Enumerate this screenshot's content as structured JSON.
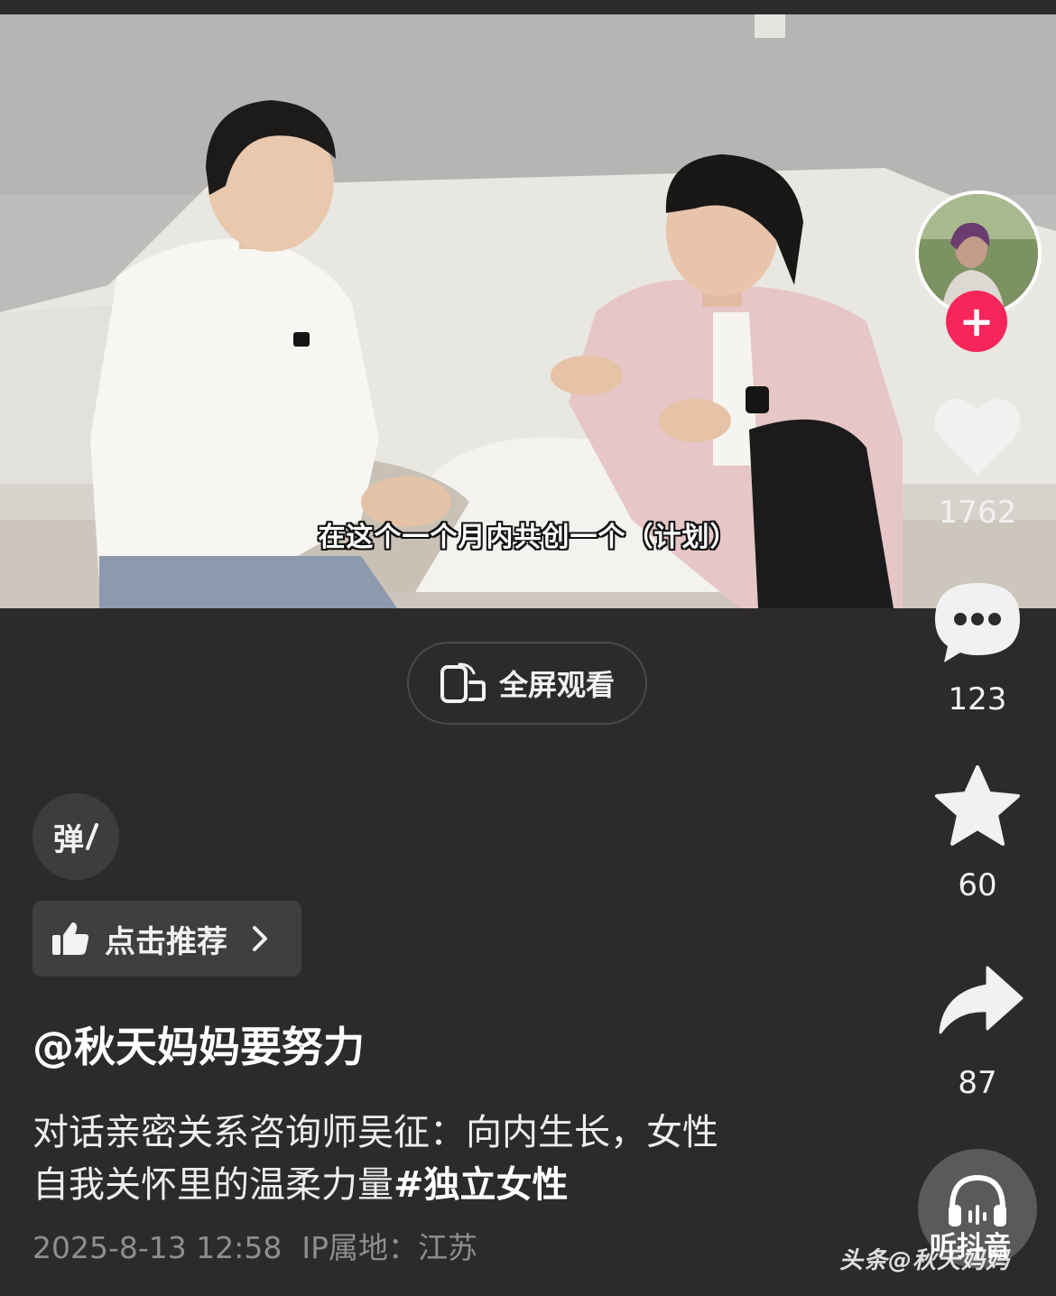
{
  "video": {
    "subtitle": "在这个一个月内共创一个（计划）"
  },
  "fullscreen": {
    "label": "全屏观看",
    "icon": "rotate-screen-icon"
  },
  "actions": {
    "follow_icon": "plus-icon",
    "like_count": "1762",
    "comment_count": "123",
    "favorite_count": "60",
    "share_count": "87",
    "listen_label": "听抖音",
    "listen_icon": "headphones-icon"
  },
  "danmaku": {
    "label": "弹"
  },
  "recommend": {
    "label": "点击推荐",
    "icon": "thumbs-up-icon"
  },
  "post": {
    "author": "@秋天妈妈要努力",
    "desc_line1": "对话亲密关系咨询师吴征：向内生长，女性",
    "desc_line2_text": "自我关怀里的温柔力量",
    "hashtag": "#独立女性",
    "datetime": "2025-8-13 12:58",
    "ip_location": "IP属地：江苏"
  },
  "watermark": "头条@秋天妈妈",
  "colors": {
    "background": "#2c2b2a",
    "follow_button": "#f6265a",
    "meta_text": "#8f8e8c"
  }
}
